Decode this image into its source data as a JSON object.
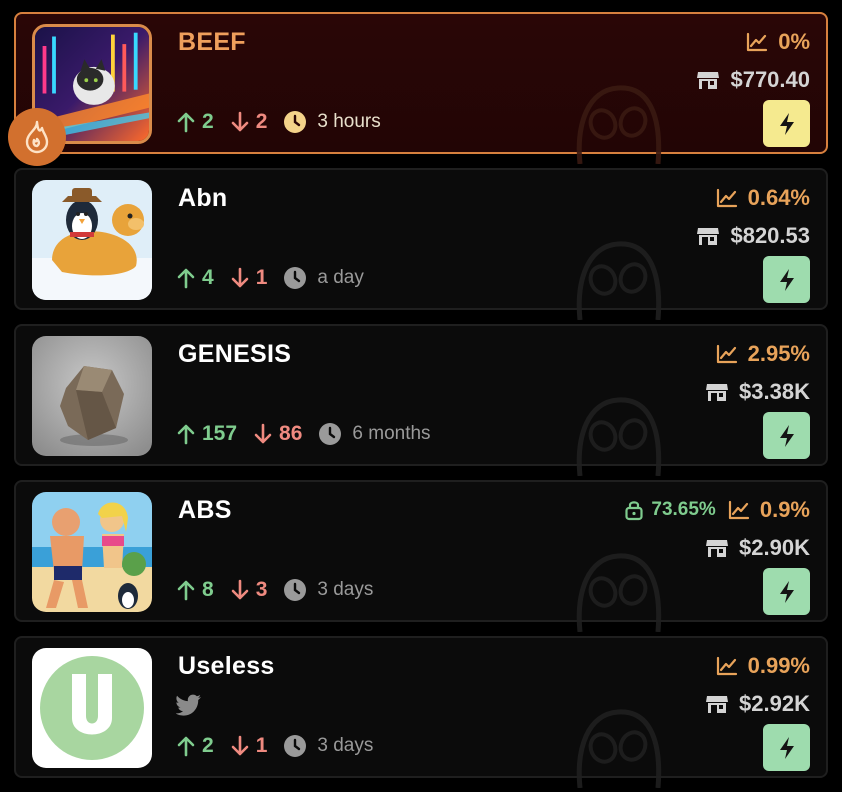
{
  "tokens": [
    {
      "name": "BEEF",
      "featured": true,
      "has_twitter": false,
      "upvotes": "2",
      "downvotes": "2",
      "age": "3 hours",
      "locked_pct": "",
      "change_pct": "0%",
      "market_cap": "$770.40",
      "image": "cat-neon-art"
    },
    {
      "name": "Abn",
      "featured": false,
      "has_twitter": false,
      "upvotes": "4",
      "downvotes": "1",
      "age": "a day",
      "locked_pct": "",
      "change_pct": "0.64%",
      "market_cap": "$820.53",
      "image": "penguin-riding-dog"
    },
    {
      "name": "GENESIS",
      "featured": false,
      "has_twitter": false,
      "upvotes": "157",
      "downvotes": "86",
      "age": "6 months",
      "locked_pct": "",
      "change_pct": "2.95%",
      "market_cap": "$3.38K",
      "image": "rock"
    },
    {
      "name": "ABS",
      "featured": false,
      "has_twitter": false,
      "upvotes": "8",
      "downvotes": "3",
      "age": "3 days",
      "locked_pct": "73.65%",
      "change_pct": "0.9%",
      "market_cap": "$2.90K",
      "image": "beach-characters"
    },
    {
      "name": "Useless",
      "featured": false,
      "has_twitter": true,
      "upvotes": "2",
      "downvotes": "1",
      "age": "3 days",
      "locked_pct": "",
      "change_pct": "0.99%",
      "market_cap": "$2.92K",
      "image": "letter-u-logo"
    }
  ],
  "icons": {
    "upvote": "arrow-up-icon",
    "downvote": "arrow-down-icon",
    "age": "clock-icon",
    "change": "chart-line-icon",
    "market_cap": "store-icon",
    "locked": "lock-icon",
    "action": "lightning-bolt-icon",
    "featured_badge": "flame-icon",
    "social": "twitter-icon"
  },
  "colors": {
    "accent_orange": "#e8a35a",
    "up_green": "#7fcc8e",
    "down_red": "#ef8a80",
    "bolt_button": "#9edcae",
    "bolt_button_featured": "#f5ea8f",
    "featured_border": "#d7803e"
  }
}
